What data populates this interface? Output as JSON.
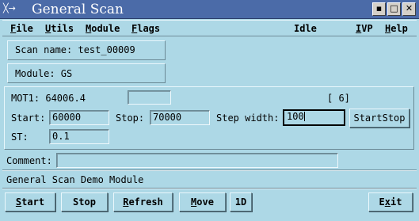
{
  "window": {
    "title": "General Scan",
    "system_icon": "╳→"
  },
  "menubar": {
    "file": {
      "key": "F",
      "rest": "ile"
    },
    "utils": {
      "key": "U",
      "rest": "tils"
    },
    "module": {
      "key": "M",
      "rest": "odule"
    },
    "flags": {
      "key": "F",
      "rest": "lags"
    },
    "status": "Idle",
    "ivp": {
      "key": "I",
      "rest": "VP"
    },
    "help": {
      "key": "H",
      "rest": "elp"
    }
  },
  "scan_name": "Scan name: test_00009",
  "module_label": "Module: GS",
  "motor": {
    "readout": "MOT1: 64006.4",
    "index": "[ 6]",
    "value_field": ""
  },
  "params": {
    "start_label": "Start:",
    "start_value": "60000",
    "stop_label": "Stop:",
    "stop_value": "70000",
    "step_label": "Step width:",
    "step_value": "100",
    "startstop_button": "StartStop",
    "st_label": "ST:",
    "st_value": "0.1"
  },
  "comment": {
    "label": "Comment:",
    "value": ""
  },
  "module_description": "General Scan Demo Module",
  "buttons": {
    "start": {
      "key": "S",
      "rest": "tart"
    },
    "stop": "Stop",
    "refresh": {
      "key": "R",
      "rest": "efresh"
    },
    "move": {
      "key": "M",
      "rest": "ove"
    },
    "oned": "1D",
    "exit": {
      "pre": "E",
      "key": "x",
      "rest": "it"
    }
  },
  "window_controls": {
    "minimize": "▪",
    "maximize": "□",
    "close": "✕"
  }
}
